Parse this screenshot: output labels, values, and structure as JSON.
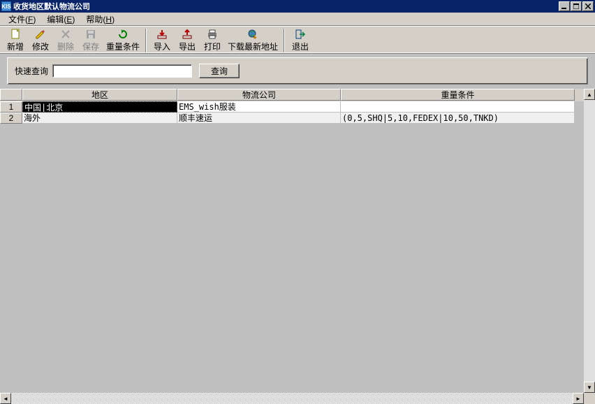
{
  "window": {
    "title": "收货地区默认物流公司",
    "icon_label": "KIS"
  },
  "menubar": [
    {
      "label": "文件",
      "key": "F"
    },
    {
      "label": "编辑",
      "key": "E"
    },
    {
      "label": "帮助",
      "key": "H"
    }
  ],
  "toolbar": {
    "new": "新增",
    "edit": "修改",
    "delete": "删除",
    "save": "保存",
    "weight_cond": "重量条件",
    "import": "导入",
    "export": "导出",
    "print": "打印",
    "download_addr": "下载最新地址",
    "exit": "退出"
  },
  "search": {
    "label": "快速查询",
    "value": "",
    "button": "查询"
  },
  "grid": {
    "headers": {
      "num": "",
      "area": "地区",
      "company": "物流公司",
      "condition": "重量条件"
    },
    "rows": [
      {
        "num": "1",
        "area": "中国|北京",
        "company": "EMS_wish服装",
        "condition": ""
      },
      {
        "num": "2",
        "area": "海外",
        "company": "顺丰速运",
        "condition": "(0,5,SHQ|5,10,FEDEX|10,50,TNKD)"
      }
    ]
  }
}
